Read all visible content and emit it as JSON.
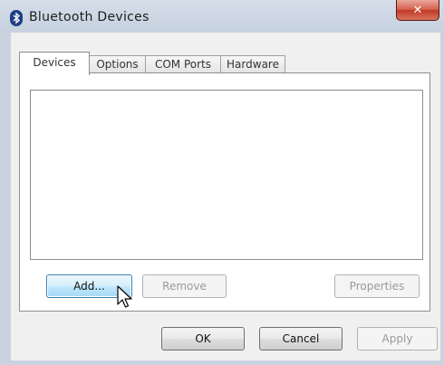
{
  "window": {
    "title": "Bluetooth Devices",
    "close_symbol": "✕",
    "icon": "bluetooth-icon"
  },
  "tabs": [
    {
      "label": "Devices",
      "active": true
    },
    {
      "label": "Options",
      "active": false
    },
    {
      "label": "COM Ports",
      "active": false
    },
    {
      "label": "Hardware",
      "active": false
    }
  ],
  "devices_panel": {
    "devices": [],
    "add_label": "Add...",
    "remove_label": "Remove",
    "properties_label": "Properties"
  },
  "footer": {
    "ok_label": "OK",
    "cancel_label": "Cancel",
    "apply_label": "Apply"
  },
  "colors": {
    "frame": "#c9d3df",
    "close_button": "#c8452f",
    "focus_button": "#bee6fd"
  }
}
